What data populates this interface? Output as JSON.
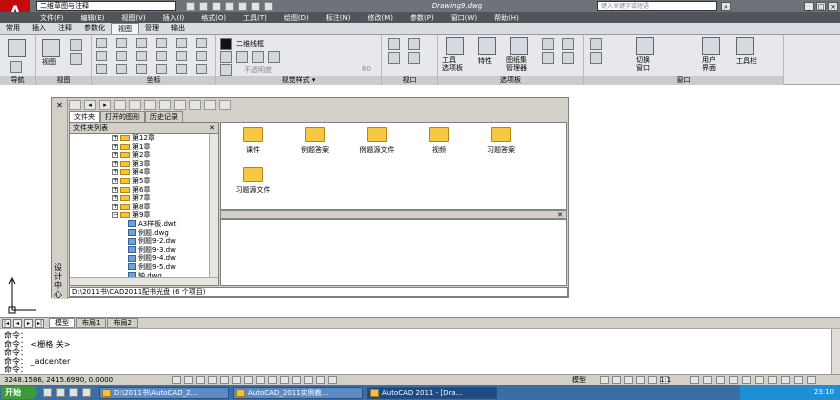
{
  "app": {
    "workspace": "二维草图与注释",
    "title": "Drawing9.dwg",
    "search_placeholder": "键入关键字或短语"
  },
  "menu": [
    "文件(F)",
    "编辑(E)",
    "视图(V)",
    "插入(I)",
    "格式(O)",
    "工具(T)",
    "绘图(D)",
    "标注(N)",
    "修改(M)",
    "参数(P)",
    "窗口(W)",
    "帮助(H)"
  ],
  "ribbon_tabs": [
    "常用",
    "插入",
    "注释",
    "参数化",
    "视图",
    "管理",
    "输出"
  ],
  "ribbon": {
    "panels": {
      "nav": "导航",
      "view": "视图",
      "coords": "坐标",
      "visual": "视觉样式 ▾",
      "viewport": "视口",
      "palettes": "选项板",
      "window": "窗口"
    },
    "view_btn": "视图",
    "visual_style": "二维线框",
    "visual_input_placeholder": "不透明度",
    "visual_value": "60",
    "tool_palette": "工具\n选项板",
    "properties": "特性",
    "sheetset": "图纸集\n管理器",
    "switch_window": "切换\n窗口",
    "user_interface": "用户\n界面",
    "toolbars": "工具栏"
  },
  "design_center": {
    "side_title": "设计中心",
    "tabs": [
      "文件夹",
      "打开的图形",
      "历史记录"
    ],
    "tree_header": "文件夹列表",
    "tree": [
      {
        "label": "第12章",
        "type": "folder",
        "indent": 1
      },
      {
        "label": "第1章",
        "type": "folder",
        "indent": 1
      },
      {
        "label": "第2章",
        "type": "folder",
        "indent": 1
      },
      {
        "label": "第3章",
        "type": "folder",
        "indent": 1
      },
      {
        "label": "第4章",
        "type": "folder",
        "indent": 1
      },
      {
        "label": "第5章",
        "type": "folder",
        "indent": 1
      },
      {
        "label": "第6章",
        "type": "folder",
        "indent": 1
      },
      {
        "label": "第7章",
        "type": "folder",
        "indent": 1
      },
      {
        "label": "第8章",
        "type": "folder",
        "indent": 1
      },
      {
        "label": "第9章",
        "type": "folder",
        "indent": 1
      },
      {
        "label": "A3样板.dwt",
        "type": "file",
        "indent": 2
      },
      {
        "label": "例题.dwg",
        "type": "file",
        "indent": 2
      },
      {
        "label": "例题9-2.dw",
        "type": "file",
        "indent": 2
      },
      {
        "label": "例题9-3.dw",
        "type": "file",
        "indent": 2
      },
      {
        "label": "例题9-4.dw",
        "type": "file",
        "indent": 2
      },
      {
        "label": "例题9-5.dw",
        "type": "file",
        "indent": 2
      },
      {
        "label": "轴.dwg",
        "type": "file",
        "indent": 2
      }
    ],
    "content_items": [
      "课件",
      "例题答案",
      "例题源文件",
      "视频",
      "习题答案",
      "习题源文件"
    ],
    "status": "D:\\2011书\\CAD2011配书光盘 (6 个项目)"
  },
  "layout_tabs": [
    "模型",
    "布局1",
    "布局2"
  ],
  "command_lines": [
    "命令：",
    "命令： <栅格 关>",
    "命令：",
    "命令： _adcenter",
    "命令："
  ],
  "status": {
    "coords": "3248.1586, 2415.6990, 0.0000",
    "model": "模型",
    "scale": "1:1"
  },
  "taskbar": {
    "start": "开始",
    "items": [
      "D:\\2011书\\AutoCAD_2...",
      "AutoCAD_2011实例教...",
      "AutoCAD 2011 - [Dra..."
    ],
    "clock": "23:10"
  }
}
